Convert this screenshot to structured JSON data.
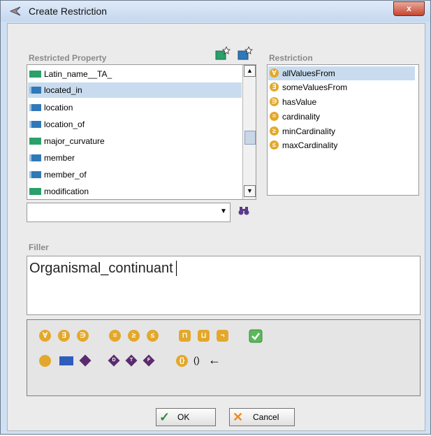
{
  "window": {
    "title": "Create Restriction",
    "close_glyph": "x"
  },
  "restricted_property": {
    "label": "Restricted Property",
    "items": [
      {
        "name": "Latin_name__TA_",
        "kind": "datatype",
        "selected": false
      },
      {
        "name": "located_in",
        "kind": "object",
        "selected": true
      },
      {
        "name": "location",
        "kind": "object",
        "selected": false
      },
      {
        "name": "location_of",
        "kind": "object",
        "selected": false
      },
      {
        "name": "major_curvature",
        "kind": "datatype",
        "selected": false
      },
      {
        "name": "member",
        "kind": "object",
        "selected": false
      },
      {
        "name": "member_of",
        "kind": "object",
        "selected": false
      },
      {
        "name": "modification",
        "kind": "datatype",
        "selected": false
      }
    ],
    "search_value": ""
  },
  "restriction": {
    "label": "Restriction",
    "items": [
      {
        "name": "allValuesFrom",
        "symbol": "∀",
        "selected": true
      },
      {
        "name": "someValuesFrom",
        "symbol": "∃",
        "selected": false
      },
      {
        "name": "hasValue",
        "symbol": "∋",
        "selected": false
      },
      {
        "name": "cardinality",
        "symbol": "=",
        "selected": false
      },
      {
        "name": "minCardinality",
        "symbol": "≥",
        "selected": false
      },
      {
        "name": "maxCardinality",
        "symbol": "≤",
        "selected": false
      }
    ]
  },
  "filler": {
    "label": "Filler",
    "value": "Organismal_continuant"
  },
  "toolbar": {
    "row1": [
      "∀",
      "∃",
      "∋",
      "=",
      "≥",
      "≤",
      "⊓",
      "⊔",
      "¬"
    ],
    "row2_diamonds": [
      "D",
      "T",
      "F"
    ],
    "row2_text": [
      "()",
      "←"
    ]
  },
  "buttons": {
    "ok_label": "OK",
    "cancel_label": "Cancel"
  },
  "colors": {
    "restriction_icon": "#e3a82b",
    "datatype_prop": "#2aa06a",
    "object_prop": "#2f79b8",
    "selection": "#c9dcef"
  }
}
